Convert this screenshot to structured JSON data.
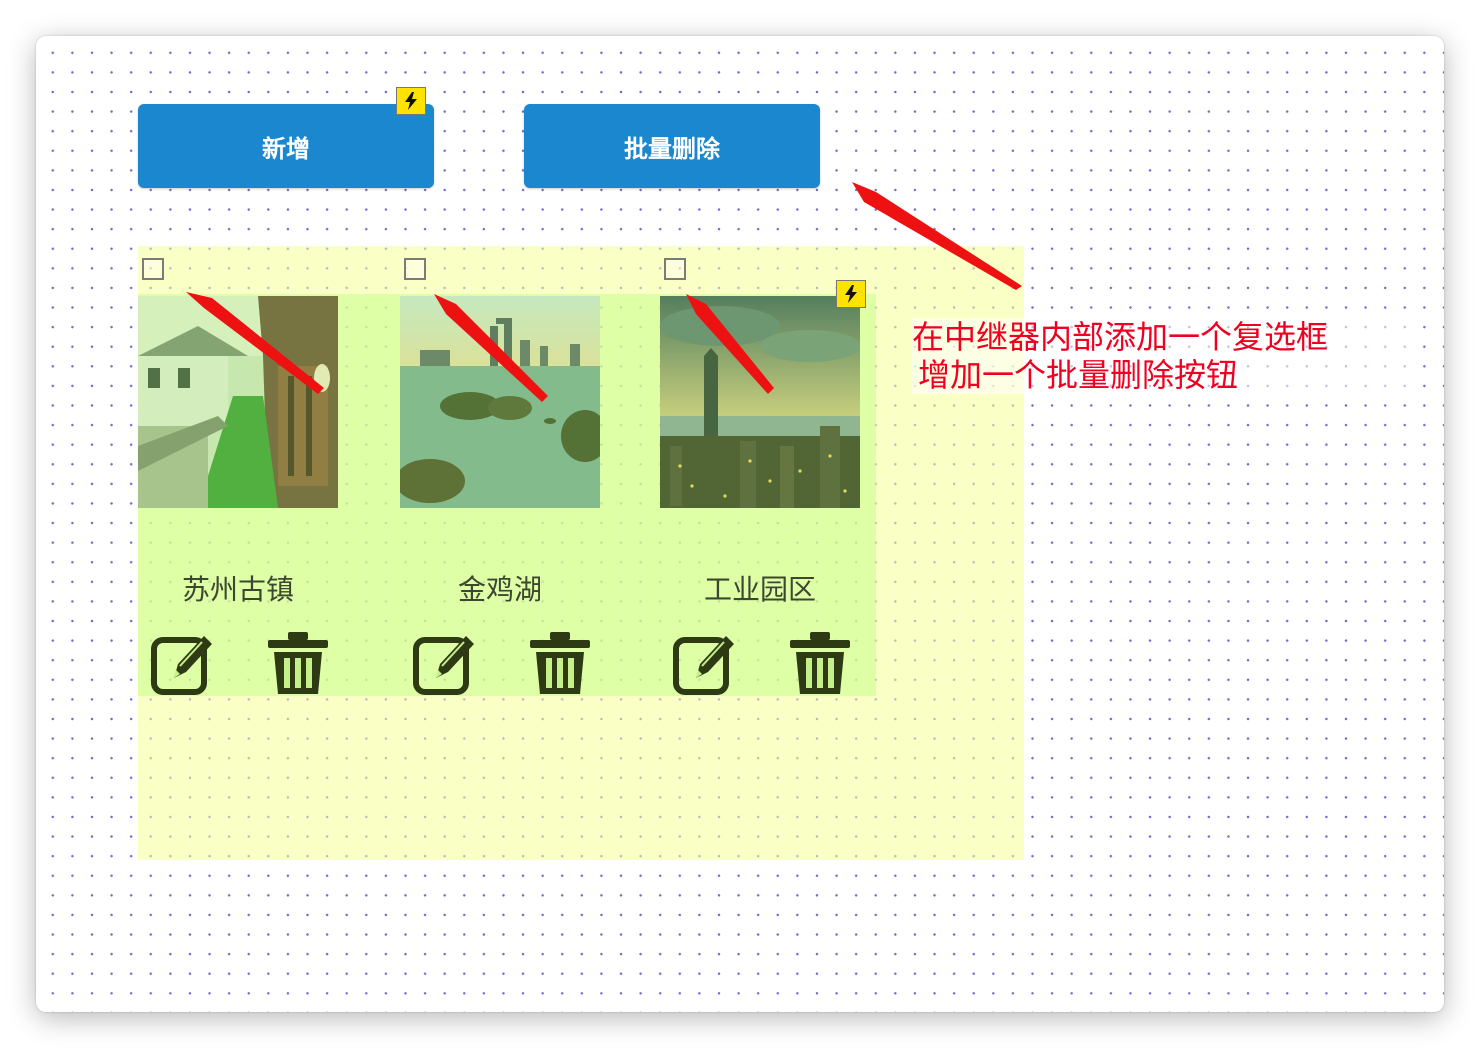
{
  "toolbar": {
    "add_label": "新增",
    "batch_delete_label": "批量删除"
  },
  "cards": [
    {
      "title": "苏州古镇",
      "image": "ancient-town-canal"
    },
    {
      "title": "金鸡湖",
      "image": "lake-rocks-skyline"
    },
    {
      "title": "工业园区",
      "image": "city-skyline-aerial"
    }
  ],
  "annotation": {
    "line1": "在中继器内部添加一个复选框",
    "line2": "增加一个批量删除按钮"
  },
  "colors": {
    "button": "#1b87cf",
    "annotation": "#f00020",
    "badge": "#ffe300"
  },
  "icons": [
    "lightning-icon",
    "checkbox-icon",
    "edit-icon",
    "trash-icon",
    "arrow-icon"
  ]
}
